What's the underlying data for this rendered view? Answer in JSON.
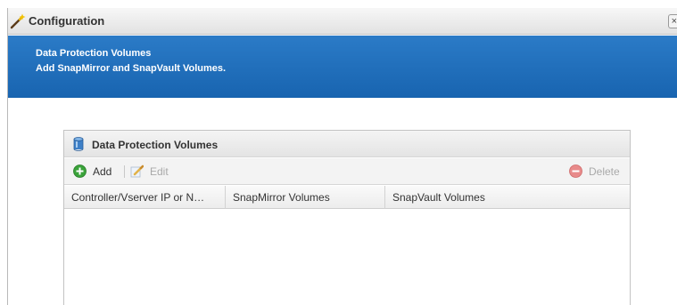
{
  "window": {
    "title": "Configuration",
    "close_glyph": "×"
  },
  "banner": {
    "heading": "Data Protection Volumes",
    "subheading": "Add SnapMirror and SnapVault Volumes."
  },
  "panel": {
    "title": "Data Protection Volumes",
    "toolbar": {
      "add_label": "Add",
      "edit_label": "Edit",
      "delete_label": "Delete"
    },
    "columns": [
      "Controller/Vserver IP or N…",
      "SnapMirror Volumes",
      "SnapVault Volumes"
    ],
    "rows": []
  },
  "colors": {
    "banner": "#1f6fbd",
    "add_icon": "#3aa33a",
    "delete_icon": "#e57373"
  },
  "icons": {
    "window": "magic-wand-icon",
    "panel": "database-icon",
    "add": "plus-circle-icon",
    "edit": "edit-pencil-icon",
    "delete": "minus-circle-icon"
  }
}
